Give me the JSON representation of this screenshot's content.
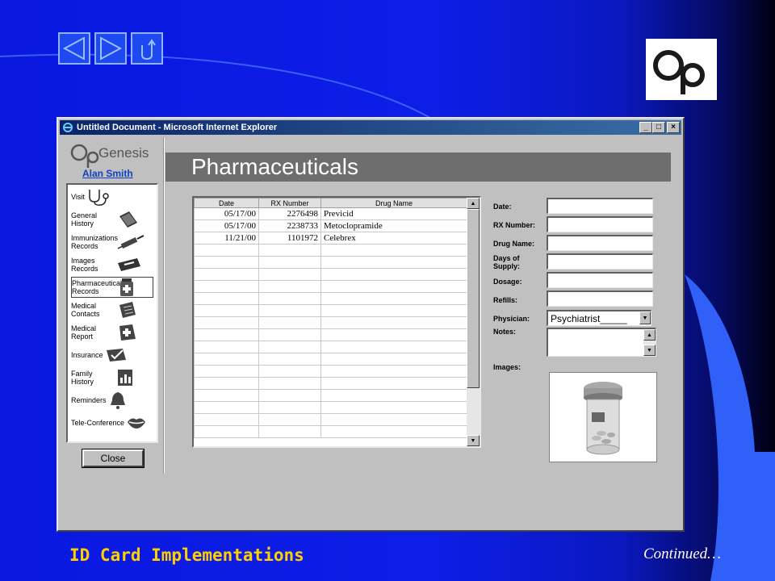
{
  "slide": {
    "footer_title": "ID Card Implementations",
    "continued": "Continued…",
    "colors": {
      "background": "#0d1ee8",
      "footer_title": "#ffd000",
      "header_bar": "#6e6e6e",
      "titlebar": "#0a246a"
    }
  },
  "nav": {
    "buttons": [
      {
        "name": "back-button",
        "icon": "triangle-left-icon"
      },
      {
        "name": "forward-button",
        "icon": "triangle-right-icon"
      },
      {
        "name": "return-button",
        "icon": "u-turn-icon"
      }
    ]
  },
  "browser": {
    "title": "Untitled Document - Microsoft Internet Explorer",
    "controls": [
      "minimize-icon",
      "maximize-icon",
      "close-icon"
    ]
  },
  "sidebar": {
    "user": "Alan Smith",
    "items": [
      {
        "label": "Visit",
        "icon": "stethoscope-icon"
      },
      {
        "label": "General History",
        "icon": "book-icon"
      },
      {
        "label": "Immunizations Records",
        "icon": "syringe-icon"
      },
      {
        "label": "Images Records",
        "icon": "xray-film-icon"
      },
      {
        "label": "Pharmaceuticals Records",
        "icon": "pill-bottle-icon"
      },
      {
        "label": "Medical Contacts",
        "icon": "contacts-card-icon"
      },
      {
        "label": "Medical Report",
        "icon": "medical-folder-icon"
      },
      {
        "label": "Insurance",
        "icon": "insurance-card-icon"
      },
      {
        "label": "Family History",
        "icon": "family-book-icon"
      },
      {
        "label": "Reminders",
        "icon": "bell-icon"
      },
      {
        "label": "Tele-Conference",
        "icon": "lips-icon"
      }
    ],
    "close_label": "Close"
  },
  "main": {
    "header": "Pharmaceuticals",
    "table": {
      "columns": [
        "Date",
        "RX Number",
        "Drug Name"
      ],
      "rows": [
        [
          "05/17/00",
          "2276498",
          "Previcid"
        ],
        [
          "05/17/00",
          "2238733",
          "Metoclopramide"
        ],
        [
          "11/21/00",
          "1101972",
          "Celebrex"
        ]
      ]
    },
    "form": {
      "date_label": "Date:",
      "rx_label": "RX Number:",
      "drug_label": "Drug Name:",
      "days_label": "Days of Supply:",
      "dosage_label": "Dosage:",
      "refills_label": "Refills:",
      "physician_label": "Physician:",
      "physician_value": "Psychiatrist_____",
      "notes_label": "Notes:",
      "images_label": "Images:"
    }
  }
}
